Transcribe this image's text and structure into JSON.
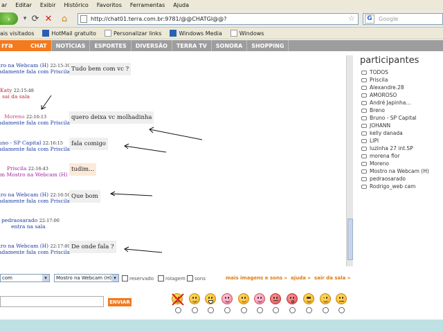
{
  "menu": [
    "ar",
    "Editar",
    "Exibir",
    "Histórico",
    "Favoritos",
    "Ferramentas",
    "Ajuda"
  ],
  "address": {
    "url": "http://chat01.terra.com.br:9781/@@CHATGI@@?",
    "search_placeholder": "Google"
  },
  "bookmarks": [
    "ais visitados",
    "HotMail gratuito",
    "Personalizar links",
    "Windows Media",
    "Windows"
  ],
  "site": {
    "logo": "rra",
    "tabs": [
      {
        "label": "CHAT",
        "active": true
      },
      {
        "label": "NOTÍCIAS"
      },
      {
        "label": "ESPORTES"
      },
      {
        "label": "DIVERSÃO"
      },
      {
        "label": "TERRA TV"
      },
      {
        "label": "SONORA"
      },
      {
        "label": "SHOPPING"
      }
    ]
  },
  "messages": [
    {
      "sender": "tro na Webcam (H)",
      "time": "22:15:39",
      "target": "adamente fala com Priscila",
      "text": "Tudo bem com vc ?",
      "color": "#1a3aa0",
      "bubble": "gray"
    },
    {
      "sender": "Katy",
      "time": "22:15:48",
      "target": "sai da sala",
      "text": "",
      "color": "#c0273b"
    },
    {
      "sender": "Moreno",
      "time": "22:16:13",
      "target": "adamente fala com Priscila",
      "text": "quero deixa vc molhadinha",
      "color": "#c24a7a",
      "target_color": "#1a3aa0",
      "bubble": "gray"
    },
    {
      "sender": "uno - SP Capital",
      "time": "22:16:15",
      "target": "adamente fala com Priscila",
      "text": "fala comigo",
      "color": "#1a3aa0",
      "bubble": "gray"
    },
    {
      "sender": "Priscila",
      "time": "22:16:43",
      "target": "m Mostro na Webcam (H)",
      "text": "tudim...",
      "color": "#a0289e",
      "bubble": "peach"
    },
    {
      "sender": "tro na Webcam (H)",
      "time": "22:16:50",
      "target": "adamente fala com Priscila",
      "text": "Que bom",
      "color": "#1a3aa0",
      "bubble": "gray"
    },
    {
      "sender": "pedraosarado",
      "time": "22:17:00",
      "target": "entra na sala",
      "text": "",
      "color": "#1a3aa0"
    },
    {
      "sender": "tro na Webcam (H)",
      "time": "22:17:00",
      "target": "adamente fala com Priscila",
      "text": "De onde fala ?",
      "color": "#1a3aa0",
      "bubble": "gray"
    }
  ],
  "participants": {
    "title": "participantes",
    "list": [
      "TODOS",
      "Priscila",
      "Alexandre.28",
      "AMOROSO",
      "André Japinha...",
      "Breno",
      "Bruno - SP Capital",
      "JOHANN",
      "kelly danada",
      "LIPI",
      "luzinha 27 int.SP",
      "morena flor",
      "Moreno",
      "Mostro na Webcam (H)",
      "pedraosarado",
      "Rodrigo_web cam"
    ]
  },
  "controls": {
    "mode_select": "com",
    "target_select": "Mostro na Webcam (H)",
    "checkboxes": [
      "reservado",
      "rolagem",
      "sons"
    ],
    "links": [
      "mais imagens e sons »",
      "ajuda »",
      "sair da sala »"
    ],
    "send_label": "ENVIAR"
  },
  "emoticons": [
    "no-emoticon",
    "smile",
    "laugh",
    "grin",
    "tongue",
    "happy",
    "angry",
    "surprised",
    "cool",
    "wink",
    "sad"
  ]
}
